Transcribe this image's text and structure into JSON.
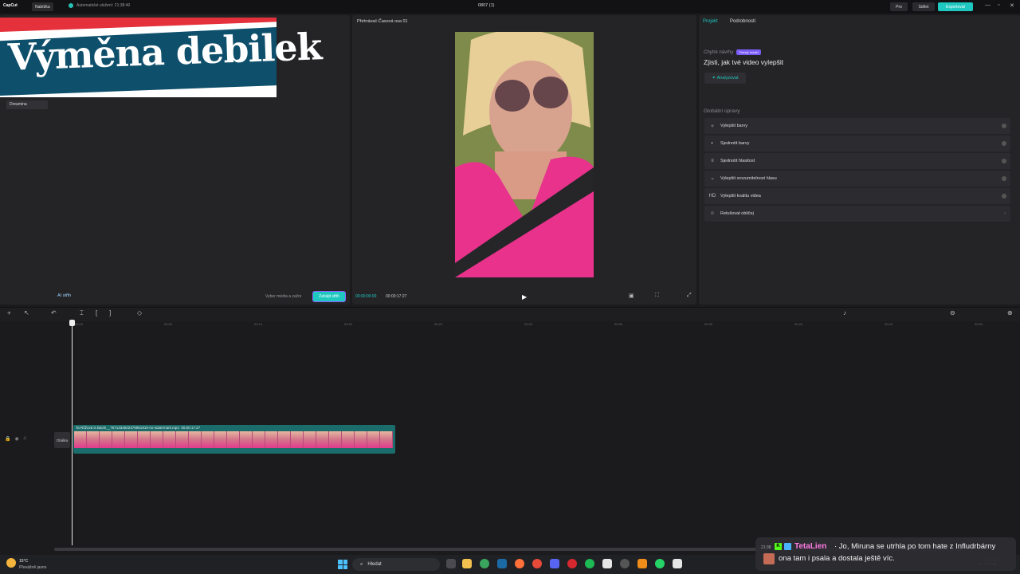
{
  "app": {
    "logo": "CapCut",
    "menu_label": "Nabídka",
    "autosave": "Automatické uložení: 21:38:40",
    "doc_title": "0807 (1)",
    "pro_label": "Pro",
    "share_label": "Sdílet",
    "export_label": "Exportovat"
  },
  "overlay": {
    "banner_text": "Výměna debilek"
  },
  "media": {
    "sidebar_item": "Dreamina",
    "ai_label": "AI střih",
    "select_text": "Vyber média a začni",
    "start_label": "Zahájit střih"
  },
  "player": {
    "title": "Přehrávač-Časová osa 01",
    "tc_current": "00:00:00:00",
    "tc_total": "00:00:17:27"
  },
  "props": {
    "tab_project": "Projekt",
    "tab_details": "Podrobnosti",
    "smart_label": "Chytré návrhy",
    "smart_badge": "Trendy model",
    "smart_heading": "Zjisti, jak tvé video vylepšit",
    "analyze_label": "Analyzovat",
    "global_label": "Globální úpravy",
    "options": [
      "Vylepšit barvy",
      "Sjednotit barvy",
      "Sjednotit hlasitost",
      "Vylepšit srozumitelnost hlasu",
      "Vylepšit kvalitu videa",
      "Retušovat obličej"
    ]
  },
  "timeline": {
    "ticks": [
      "00:00",
      "00:05",
      "00:10",
      "00:15",
      "00:20",
      "00:25",
      "00:30",
      "00:35",
      "00:40",
      "00:45",
      "00:50"
    ],
    "cover_label": "Obálka",
    "clip_name": "Ta Růžová is Back!__7671334502479961910-no-watermark.mp4",
    "clip_duration": "00:00:17:27"
  },
  "taskbar": {
    "temp": "15°C",
    "weather": "Převážně jasno",
    "search_placeholder": "Hledat",
    "time": "21:38",
    "date": "07.08.2025"
  },
  "chat": {
    "time": "21:38",
    "user": "TetaLien",
    "line1": "· Jo, Miruna se utrhla po tom hate z Infludrbárny",
    "line2": "ona tam i psala a dostala ještě víc."
  }
}
